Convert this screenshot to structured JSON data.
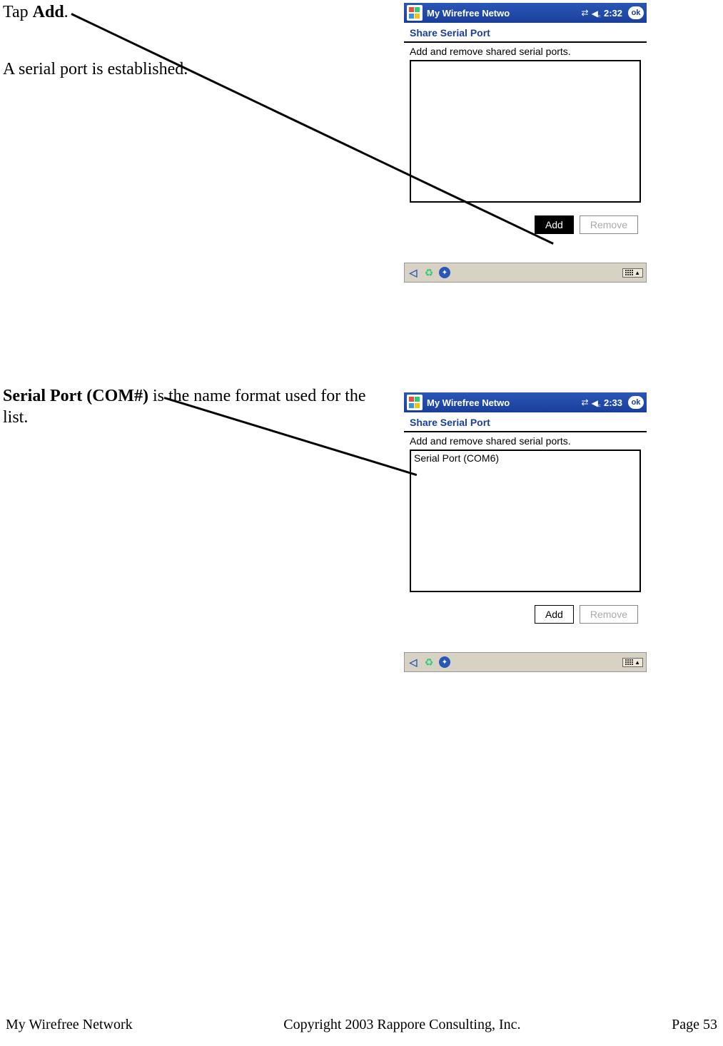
{
  "instructions": {
    "tapAdd_pre": "Tap ",
    "tapAdd_bold": "Add",
    "tapAdd_post": ".",
    "established": "A serial port is established.",
    "serialPort_bold": "Serial Port (COM#)",
    "serialPort_rest": " is the name format used for the list."
  },
  "pda1": {
    "title": "My Wirefree Netwo",
    "time": "2:32",
    "ok": "ok",
    "subtitle": "Share Serial Port",
    "desc": "Add and remove shared serial ports.",
    "add": "Add",
    "remove": "Remove"
  },
  "pda2": {
    "title": "My Wirefree Netwo",
    "time": "2:33",
    "ok": "ok",
    "subtitle": "Share Serial Port",
    "desc": "Add and remove shared serial ports.",
    "listItem": "Serial Port (COM6)",
    "add": "Add",
    "remove": "Remove"
  },
  "footer": {
    "left": "My Wirefree Network",
    "center": "Copyright 2003 Rappore Consulting, Inc.",
    "right": "Page 53"
  }
}
